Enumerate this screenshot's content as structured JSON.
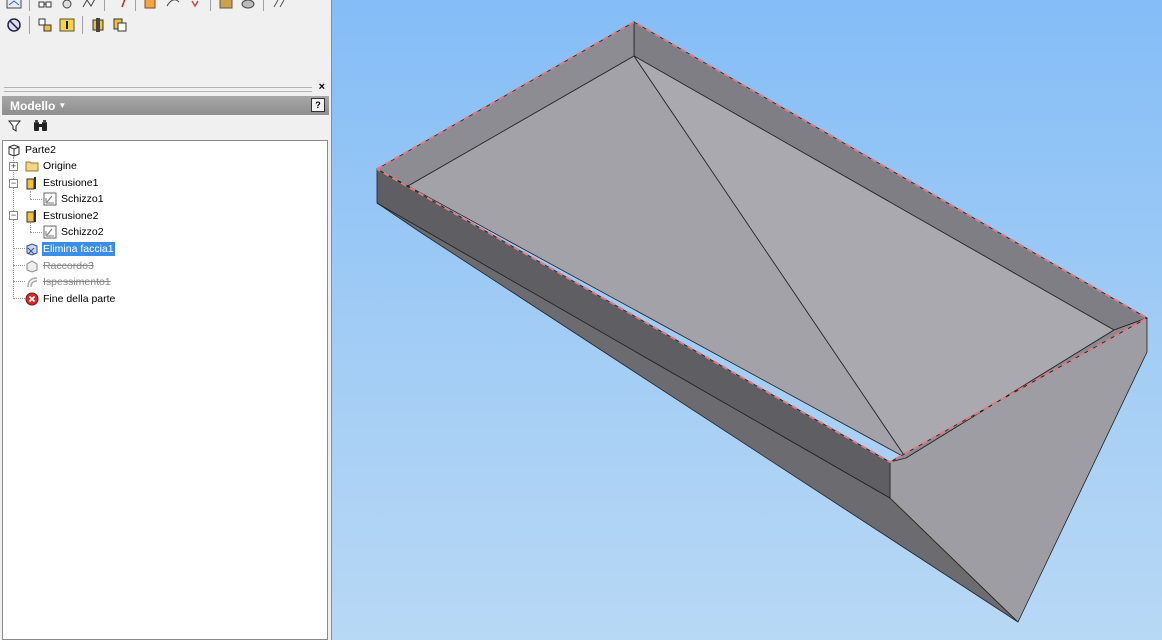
{
  "toolbar": {
    "row1_icons": [
      "sketch-icon",
      "constraint-icon",
      "pattern-icon",
      "dimension-icon",
      "project-icon",
      "fillet-icon",
      "chamfer-icon",
      "hole-icon",
      "workplane-icon",
      "axis-icon",
      "point-icon"
    ],
    "row2_icons": [
      "no-entry-icon",
      "move-face-icon",
      "info-icon",
      "derive-icon",
      "copy-object-icon"
    ]
  },
  "splitter": {
    "close": "×"
  },
  "browser": {
    "title": "Modello",
    "help": "?",
    "filter_icon": "filter-icon",
    "find_icon": "binoculars-icon"
  },
  "tree": {
    "items": [
      {
        "label": "Parte2",
        "icon": "part-icon",
        "state": "normal"
      },
      {
        "label": "Origine",
        "icon": "folder-icon",
        "state": "normal"
      },
      {
        "label": "Estrusione1",
        "icon": "extrude-icon",
        "state": "normal"
      },
      {
        "label": "Schizzo1",
        "icon": "sketch-icon",
        "state": "normal"
      },
      {
        "label": "Estrusione2",
        "icon": "extrude-icon",
        "state": "normal"
      },
      {
        "label": "Schizzo2",
        "icon": "sketch-icon",
        "state": "normal"
      },
      {
        "label": "Elimina faccia1",
        "icon": "delete-face-icon",
        "state": "selected"
      },
      {
        "label": "Raccordo3",
        "icon": "fillet-icon",
        "state": "suppressed"
      },
      {
        "label": "Ispessimento1",
        "icon": "thicken-icon",
        "state": "suppressed"
      },
      {
        "label": "Fine della parte",
        "icon": "end-of-part-icon",
        "state": "normal"
      }
    ]
  },
  "viewport": {
    "model": "tray-part",
    "colors": {
      "background_top": "#84bdf7",
      "background_bottom": "#b8d8f5",
      "face_top": "#a6a6ab",
      "highlight_edge": "#e07a80",
      "selection": "#3a8ee6"
    }
  }
}
